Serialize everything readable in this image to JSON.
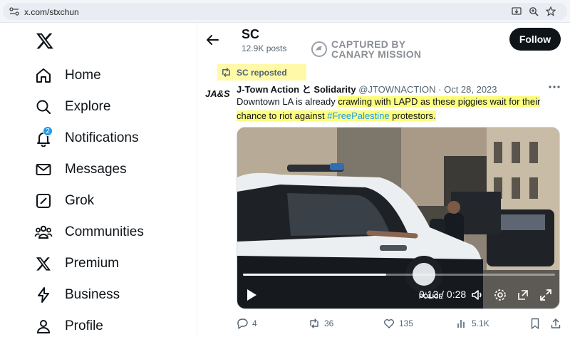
{
  "browser": {
    "url": "x.com/stxchun",
    "icons": [
      "site-settings-icon",
      "install-app-icon",
      "zoom-icon",
      "bookmark-star-icon"
    ]
  },
  "nav": {
    "items": [
      {
        "label": "Home",
        "icon": "home-icon"
      },
      {
        "label": "Explore",
        "icon": "search-icon"
      },
      {
        "label": "Notifications",
        "icon": "bell-icon",
        "badge": "2"
      },
      {
        "label": "Messages",
        "icon": "envelope-icon"
      },
      {
        "label": "Grok",
        "icon": "grok-icon"
      },
      {
        "label": "Communities",
        "icon": "communities-icon"
      },
      {
        "label": "Premium",
        "icon": "x-logo-icon"
      },
      {
        "label": "Business",
        "icon": "lightning-icon"
      },
      {
        "label": "Profile",
        "icon": "person-icon"
      }
    ]
  },
  "header": {
    "name": "SC",
    "post_count": "12.9K posts",
    "follow_label": "Follow"
  },
  "watermark": {
    "line1": "CAPTURED BY",
    "line2": "CANARY MISSION"
  },
  "repost": {
    "label": "SC reposted"
  },
  "tweet": {
    "avatar_text": "JA&S",
    "author": "J-Town Action と Solidarity",
    "handle": "@JTOWNACTION",
    "separator": "·",
    "date": "Oct 28, 2023",
    "text_plain": "Downtown LA is already ",
    "text_highlight": "crawling with LAPD as these piggies wait for their chance to riot against ",
    "hashtag": "#FreePalestine",
    "text_end": " protestors."
  },
  "video": {
    "time": "0:13 / 0:28",
    "progress": 0.46,
    "car_text": "POLICE"
  },
  "actions": {
    "replies": "4",
    "reposts": "36",
    "likes": "135",
    "views": "5.1K"
  },
  "colors": {
    "accent": "#1d9bf0",
    "highlight": "#fdfd7e",
    "text": "#0f1419",
    "secondary": "#536471"
  }
}
